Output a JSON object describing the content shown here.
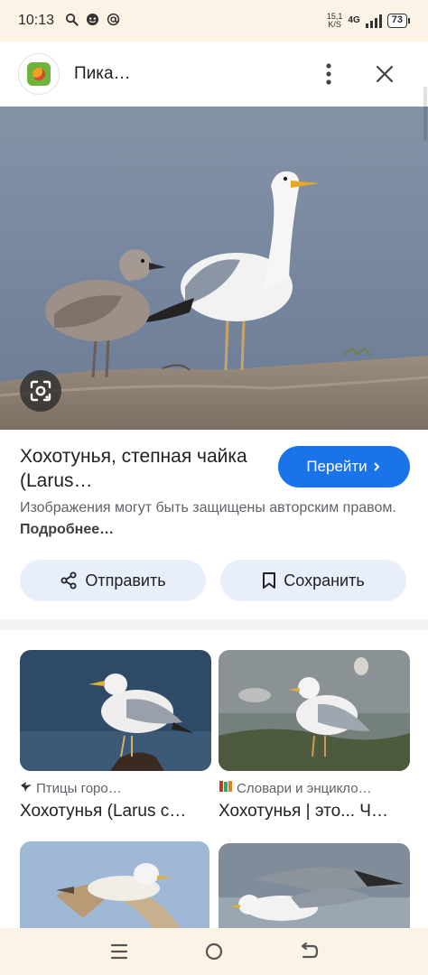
{
  "status_bar": {
    "time": "10:13",
    "icons": [
      "search-icon",
      "messenger-icon",
      "at-icon"
    ],
    "net_speed_value": "15,1",
    "net_speed_unit": "K/S",
    "network_type": "4G",
    "battery": "73"
  },
  "header": {
    "site_name": "Пика…",
    "favicon": "site-favicon"
  },
  "hero": {
    "lens_icon": "google-lens-icon"
  },
  "info": {
    "title": "Хохотунья, степная чайка (Larus…",
    "go_button": "Перейти",
    "copyright_text": "Изображения могут быть защищены авторским правом.",
    "copyright_link": "Подробнее…"
  },
  "actions": {
    "share_label": "Отправить",
    "save_label": "Сохранить"
  },
  "related": [
    {
      "source_icon": "bird-icon",
      "source": "Птицы горо…",
      "title": "Хохотунья (Larus c…"
    },
    {
      "source_icon": "books-icon",
      "source": "Словари и энцикло…",
      "title": "Хохотунья | это... Ч…"
    }
  ],
  "colors": {
    "accent": "#1a73e8",
    "pill_bg": "#e8eefa",
    "system_bar_bg": "#fbf3e6"
  }
}
